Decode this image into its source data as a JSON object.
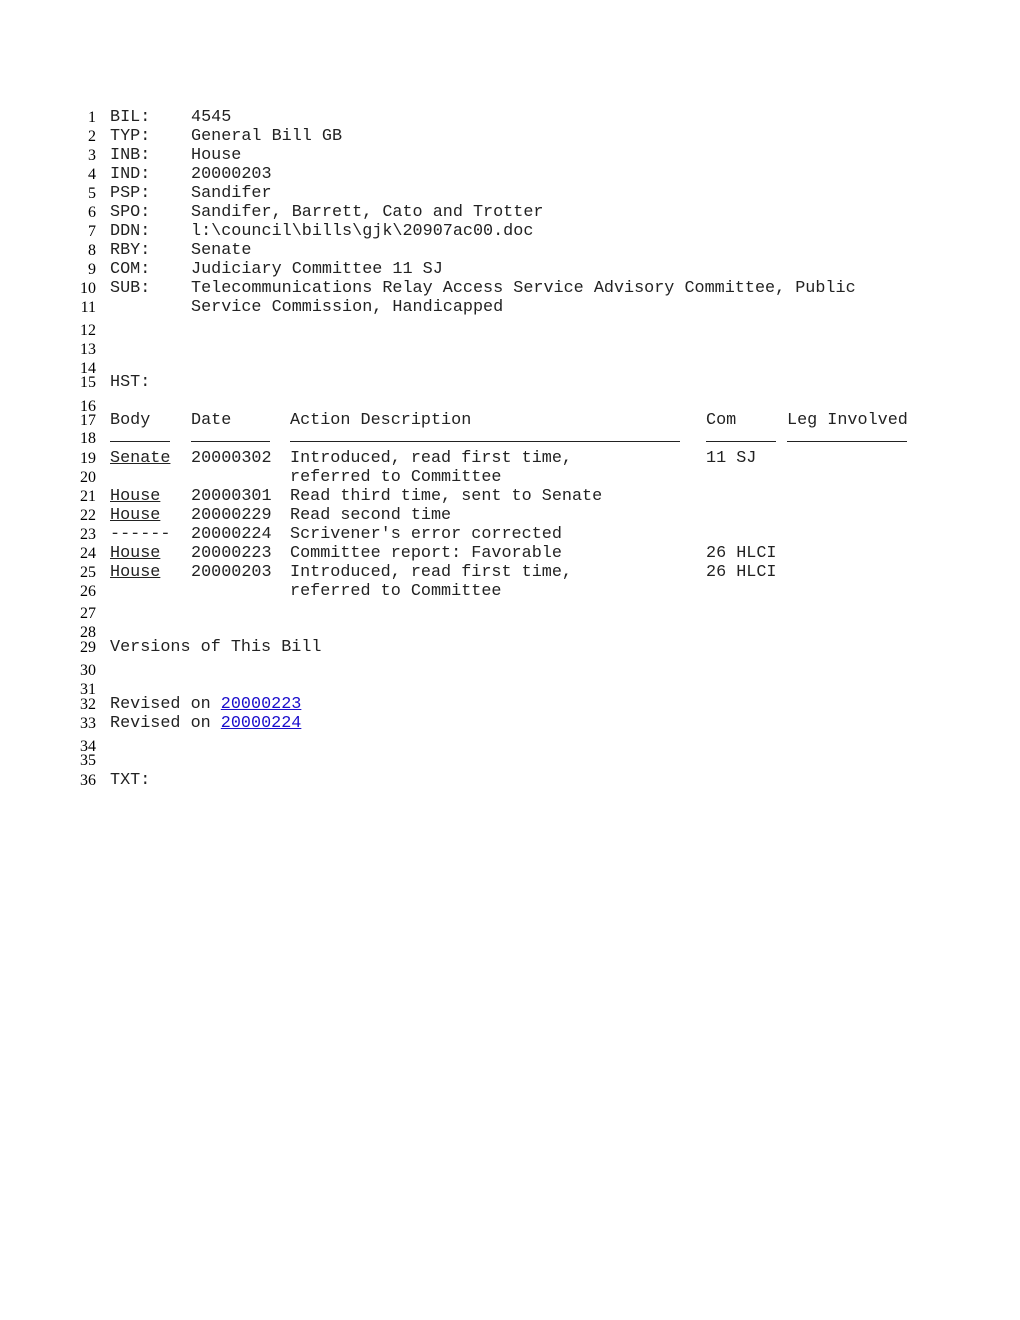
{
  "fields": {
    "bil": {
      "label": "BIL:",
      "value": "4545"
    },
    "typ": {
      "label": "TYP:",
      "value": "General Bill GB"
    },
    "inb": {
      "label": "INB:",
      "value": "House"
    },
    "ind": {
      "label": "IND:",
      "value": "20000203"
    },
    "psp": {
      "label": "PSP:",
      "value": "Sandifer"
    },
    "spo": {
      "label": "SPO:",
      "value": "Sandifer, Barrett, Cato and Trotter"
    },
    "ddn": {
      "label": "DDN:",
      "value": "l:\\council\\bills\\gjk\\20907ac00.doc"
    },
    "rby": {
      "label": "RBY:",
      "value": "Senate"
    },
    "com": {
      "label": "COM:",
      "value": "Judiciary Committee 11 SJ"
    },
    "sub": {
      "label": "SUB:",
      "value": "Telecommunications Relay Access Service Advisory Committee, Public",
      "value2": "Service Commission, Handicapped"
    }
  },
  "history": {
    "label": "HST:",
    "headers": {
      "body": "Body",
      "date": "Date",
      "action": "Action Description",
      "com": "Com",
      "leg": "Leg Involved"
    },
    "rows": [
      {
        "body": "Senate",
        "date": "20000302",
        "action": "Introduced, read first time,",
        "action2": "referred to Committee",
        "com": "11 SJ"
      },
      {
        "body": "House",
        "date": "20000301",
        "action": "Read third time, sent to Senate",
        "com": ""
      },
      {
        "body": "House",
        "date": "20000229",
        "action": "Read second time",
        "com": ""
      },
      {
        "body": "------",
        "date": "20000224",
        "action": "Scrivener's error corrected",
        "com": ""
      },
      {
        "body": "House",
        "date": "20000223",
        "action": "Committee report: Favorable",
        "com": "26 HLCI"
      },
      {
        "body": "House",
        "date": "20000203",
        "action": "Introduced, read first time,",
        "action2": "referred to Committee",
        "com": "26 HLCI"
      }
    ]
  },
  "versions": {
    "title": "Versions of This Bill",
    "items": [
      {
        "prefix": "Revised on ",
        "link": "20000223"
      },
      {
        "prefix": "Revised on ",
        "link": "20000224"
      }
    ]
  },
  "txt_label": "TXT:",
  "line_numbers": [
    "1",
    "2",
    "3",
    "4",
    "5",
    "6",
    "7",
    "8",
    "9",
    "10",
    "11",
    "12",
    "13",
    "14",
    "15",
    "16",
    "17",
    "18",
    "19",
    "20",
    "21",
    "22",
    "23",
    "24",
    "25",
    "26",
    "27",
    "28",
    "29",
    "30",
    "31",
    "32",
    "33",
    "34",
    "35",
    "36"
  ]
}
